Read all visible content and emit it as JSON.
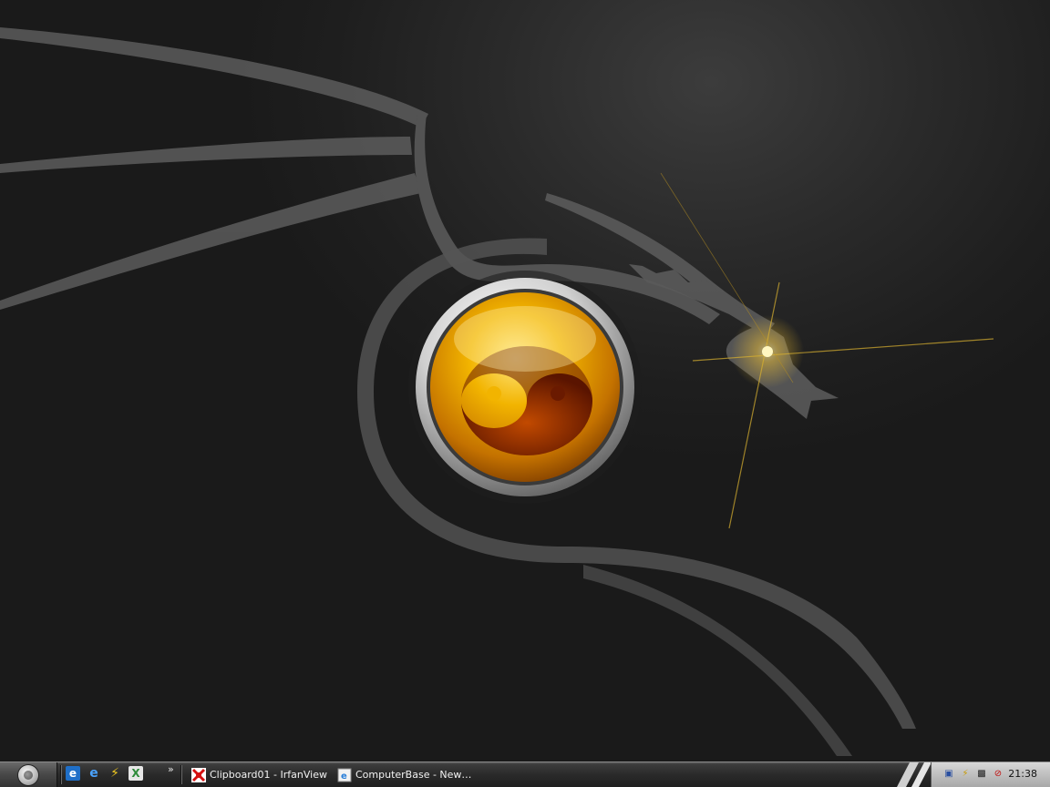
{
  "desktop": {
    "wallpaper": {
      "subject": "dragon-yin-yang",
      "orb_color": "#f2b400",
      "eye_glow_color": "#ffd84a"
    }
  },
  "taskbar": {
    "start_button": {
      "icon": "start-orb-icon"
    },
    "quick_launch": [
      {
        "icon": "show-desktop-icon",
        "color": "#3a8ee6"
      },
      {
        "icon": "internet-explorer-icon",
        "color": "#2a7fd8"
      },
      {
        "icon": "winamp-lightning-icon",
        "color": "#e8c020"
      },
      {
        "icon": "excel-icon",
        "color": "#2e8b3a"
      }
    ],
    "chevron": "»",
    "tasks": [
      {
        "label": "Clipboard01 - IrfanView",
        "icon": "irfanview-icon"
      },
      {
        "label": "ComputerBase - New…",
        "icon": "internet-explorer-page-icon"
      }
    ],
    "tray": {
      "icons": [
        "network-icon",
        "power-icon",
        "display-icon",
        "volume-muted-icon"
      ],
      "clock": "21:38"
    }
  }
}
